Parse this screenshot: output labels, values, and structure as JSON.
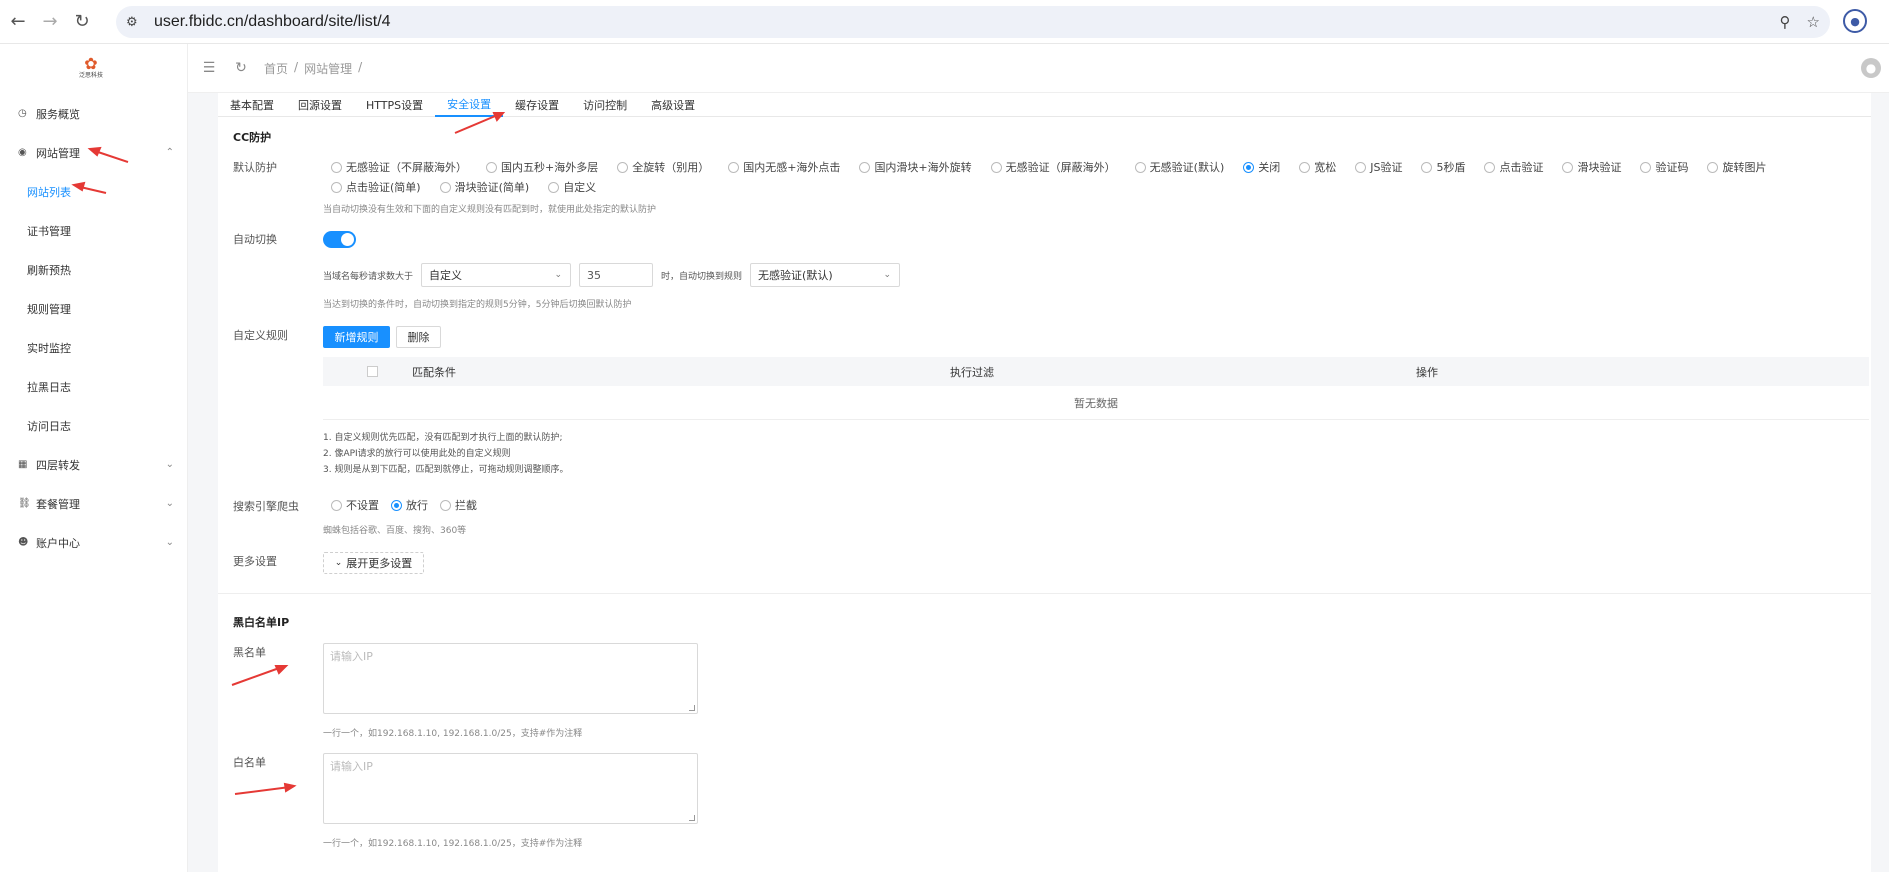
{
  "browser": {
    "back_icon": "arrow-left-icon",
    "forward_icon": "arrow-right-icon",
    "reload_icon": "reload-icon",
    "url": "user.fbidc.cn/dashboard/site/list/4"
  },
  "header": {
    "breadcrumb": [
      "首页",
      "/",
      "网站管理",
      "/"
    ]
  },
  "sidebar": {
    "logo_text": "泛思科技",
    "items": [
      {
        "label": "服务概览",
        "icon": "clock-icon"
      },
      {
        "label": "网站管理",
        "icon": "eye-icon",
        "arrow": "^"
      },
      {
        "label": "网站列表"
      },
      {
        "label": "证书管理"
      },
      {
        "label": "刷新预热"
      },
      {
        "label": "规则管理"
      },
      {
        "label": "实时监控"
      },
      {
        "label": "拉黑日志"
      },
      {
        "label": "访问日志"
      },
      {
        "label": "四层转发",
        "icon": "grid-icon",
        "arrow": "v"
      },
      {
        "label": "套餐管理",
        "icon": "basket-icon",
        "arrow": "v"
      },
      {
        "label": "账户中心",
        "icon": "user-icon",
        "arrow": "v"
      }
    ]
  },
  "tabs": [
    "基本配置",
    "回源设置",
    "HTTPS设置",
    "安全设置",
    "缓存设置",
    "访问控制",
    "高级设置"
  ],
  "active_tab": "安全设置",
  "cc": {
    "title": "CC防护",
    "default_label": "默认防护",
    "options": [
      "无感验证（不屏蔽海外）",
      "国内五秒+海外多层",
      "全旋转（别用）",
      "国内无感+海外点击",
      "国内滑块+海外旋转",
      "无感验证（屏蔽海外）",
      "无感验证(默认)",
      "关闭",
      "宽松",
      "JS验证",
      "5秒盾",
      "点击验证",
      "滑块验证",
      "验证码",
      "旋转图片",
      "点击验证(简单)",
      "滑块验证(简单)",
      "自定义"
    ],
    "selected": "关闭",
    "default_hint": "当自动切换没有生效和下面的自定义规则没有匹配到时，就使用此处指定的默认防护"
  },
  "auto_switch": {
    "label": "自动切换",
    "enabled": true,
    "prefix": "当域名每秒请求数大于",
    "mode_value": "自定义",
    "threshold": "35",
    "mid": "时，自动切换到规则",
    "rule_value": "无感验证(默认)",
    "hint": "当达到切换的条件时，自动切换到指定的规则5分钟，5分钟后切换回默认防护"
  },
  "custom_rules": {
    "label": "自定义规则",
    "add_button": "新增规则",
    "delete_button": "删除",
    "columns": [
      "匹配条件",
      "执行过滤",
      "操作"
    ],
    "empty_text": "暂无数据",
    "notes": [
      "1. 自定义规则优先匹配，没有匹配到才执行上面的默认防护;",
      "2. 像API请求的放行可以使用此处的自定义规则",
      "3. 规则是从到下匹配，匹配到就停止，可拖动规则调整顺序。"
    ]
  },
  "crawler": {
    "label": "搜索引擎爬虫",
    "options": [
      "不设置",
      "放行",
      "拦截"
    ],
    "selected": "放行",
    "hint": "蜘蛛包括谷歌、百度、搜狗、360等"
  },
  "more": {
    "label": "更多设置",
    "button": "展开更多设置"
  },
  "ip_lists": {
    "title": "黑白名单IP",
    "black_label": "黑名单",
    "white_label": "白名单",
    "placeholder": "请输入IP",
    "hint": "一行一个，如192.168.1.10, 192.168.1.0/25，支持#作为注释"
  },
  "colors": {
    "accent": "#1890ff",
    "arrow": "#e53935"
  }
}
